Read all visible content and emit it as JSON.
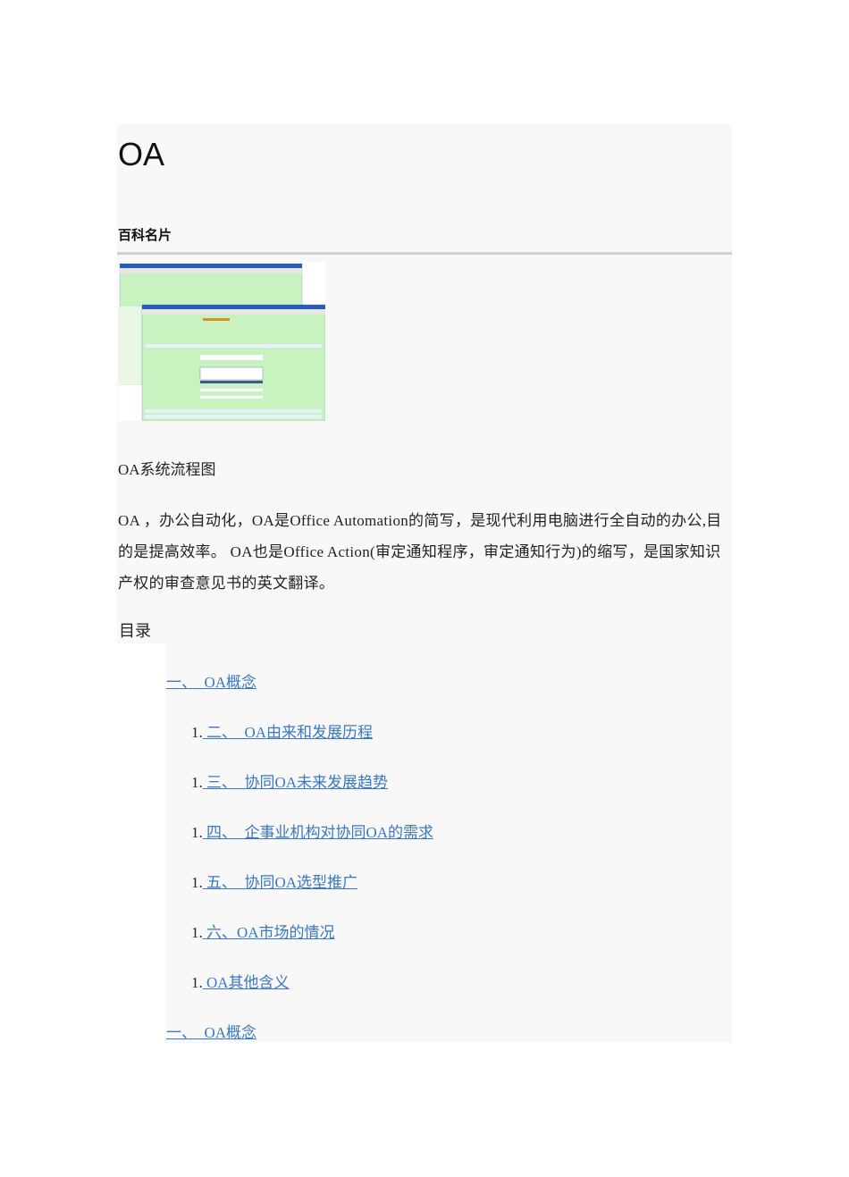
{
  "title": "OA",
  "card_heading": "百科名片",
  "image_caption": "OA系统流程图",
  "intro": "OA ，办公自动化，OA是Office Automation的简写，是现代利用电脑进行全自动的办公,目的是提高效率。 OA也是Office Action(审定通知程序，审定通知行为)的缩写，是国家知识产权的审查意见书的英文翻译。",
  "toc": {
    "heading": "目录",
    "top_item": "一、　OA概念",
    "items": [
      {
        "num": "1.",
        "label": " 二、　OA由来和发展历程"
      },
      {
        "num": "1.",
        "label": " 三、　协同OA未来发展趋势"
      },
      {
        "num": "1.",
        "label": " 四、　企事业机构对协同OA的需求"
      },
      {
        "num": "1.",
        "label": " 五、　协同OA选型推广"
      },
      {
        "num": "1.",
        "label": " 六、OA市场的情况"
      },
      {
        "num": "1.",
        "label": " OA其他含义"
      }
    ],
    "bottom_item": "一、　OA概念"
  },
  "colors": {
    "link": "#3a78c0",
    "background": "#f8f8f8",
    "screenshot_green": "#ccf5c4"
  }
}
